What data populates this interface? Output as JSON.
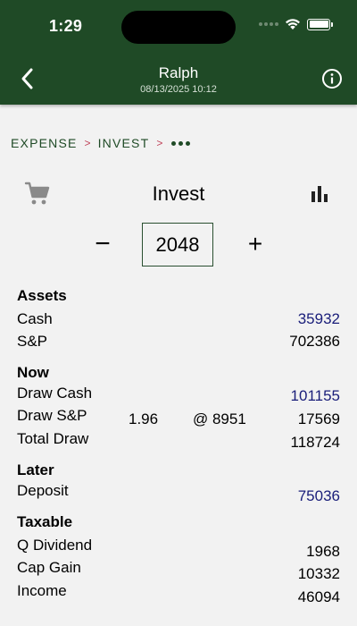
{
  "status": {
    "time": "1:29"
  },
  "header": {
    "title": "Ralph",
    "subtitle": "08/13/2025 10:12"
  },
  "breadcrumb": {
    "items": [
      "EXPENSE",
      "INVEST"
    ],
    "separator": ">"
  },
  "page": {
    "title": "Invest"
  },
  "stepper": {
    "minus": "−",
    "value": "2048",
    "plus": "+"
  },
  "assets": {
    "title": "Assets",
    "cash_label": "Cash",
    "cash_value": "35932",
    "sp_label": "S&P",
    "sp_value": "702386"
  },
  "now": {
    "title": "Now",
    "draw_cash_label": "Draw Cash",
    "draw_cash_value": "101155",
    "draw_sp_label": "Draw S&P",
    "draw_sp_rate": "1.96",
    "draw_sp_price": "@ 8951",
    "draw_sp_value": "17569",
    "total_draw_label": "Total Draw",
    "total_draw_value": "118724"
  },
  "later": {
    "title": "Later",
    "deposit_label": "Deposit",
    "deposit_value": "75036"
  },
  "taxable": {
    "title": "Taxable",
    "q_dividend_label": "Q Dividend",
    "q_dividend_value": "1968",
    "cap_gain_label": "Cap Gain",
    "cap_gain_value": "10332",
    "income_label": "Income",
    "income_value": "46094"
  },
  "colors": {
    "header_bg": "#1f4a26",
    "link_value": "#1a1e7a",
    "separator": "#c0445a"
  },
  "icons": {
    "back": "chevron-left-icon",
    "info": "info-icon",
    "cart": "cart-icon",
    "chart": "bar-chart-icon"
  }
}
